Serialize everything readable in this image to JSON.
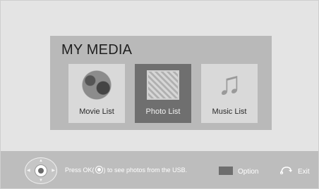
{
  "media": {
    "title": "MY MEDIA",
    "tiles": [
      {
        "label": "Movie List",
        "icon": "film-reel-icon",
        "selected": false
      },
      {
        "label": "Photo List",
        "icon": "photo-thumbnail-icon",
        "selected": true
      },
      {
        "label": "Music List",
        "icon": "music-note-icon",
        "selected": false
      }
    ]
  },
  "footer": {
    "hint_before": "Press OK(",
    "hint_after": ") to see photos from the USB.",
    "option_label": "Option",
    "exit_label": "Exit"
  },
  "colors": {
    "background": "#e4e4e4",
    "panel": "#b9b9b9",
    "tile": "#d9d9d9",
    "tile_selected": "#6f6f6f",
    "footer_bar": "#bdbdbd"
  }
}
